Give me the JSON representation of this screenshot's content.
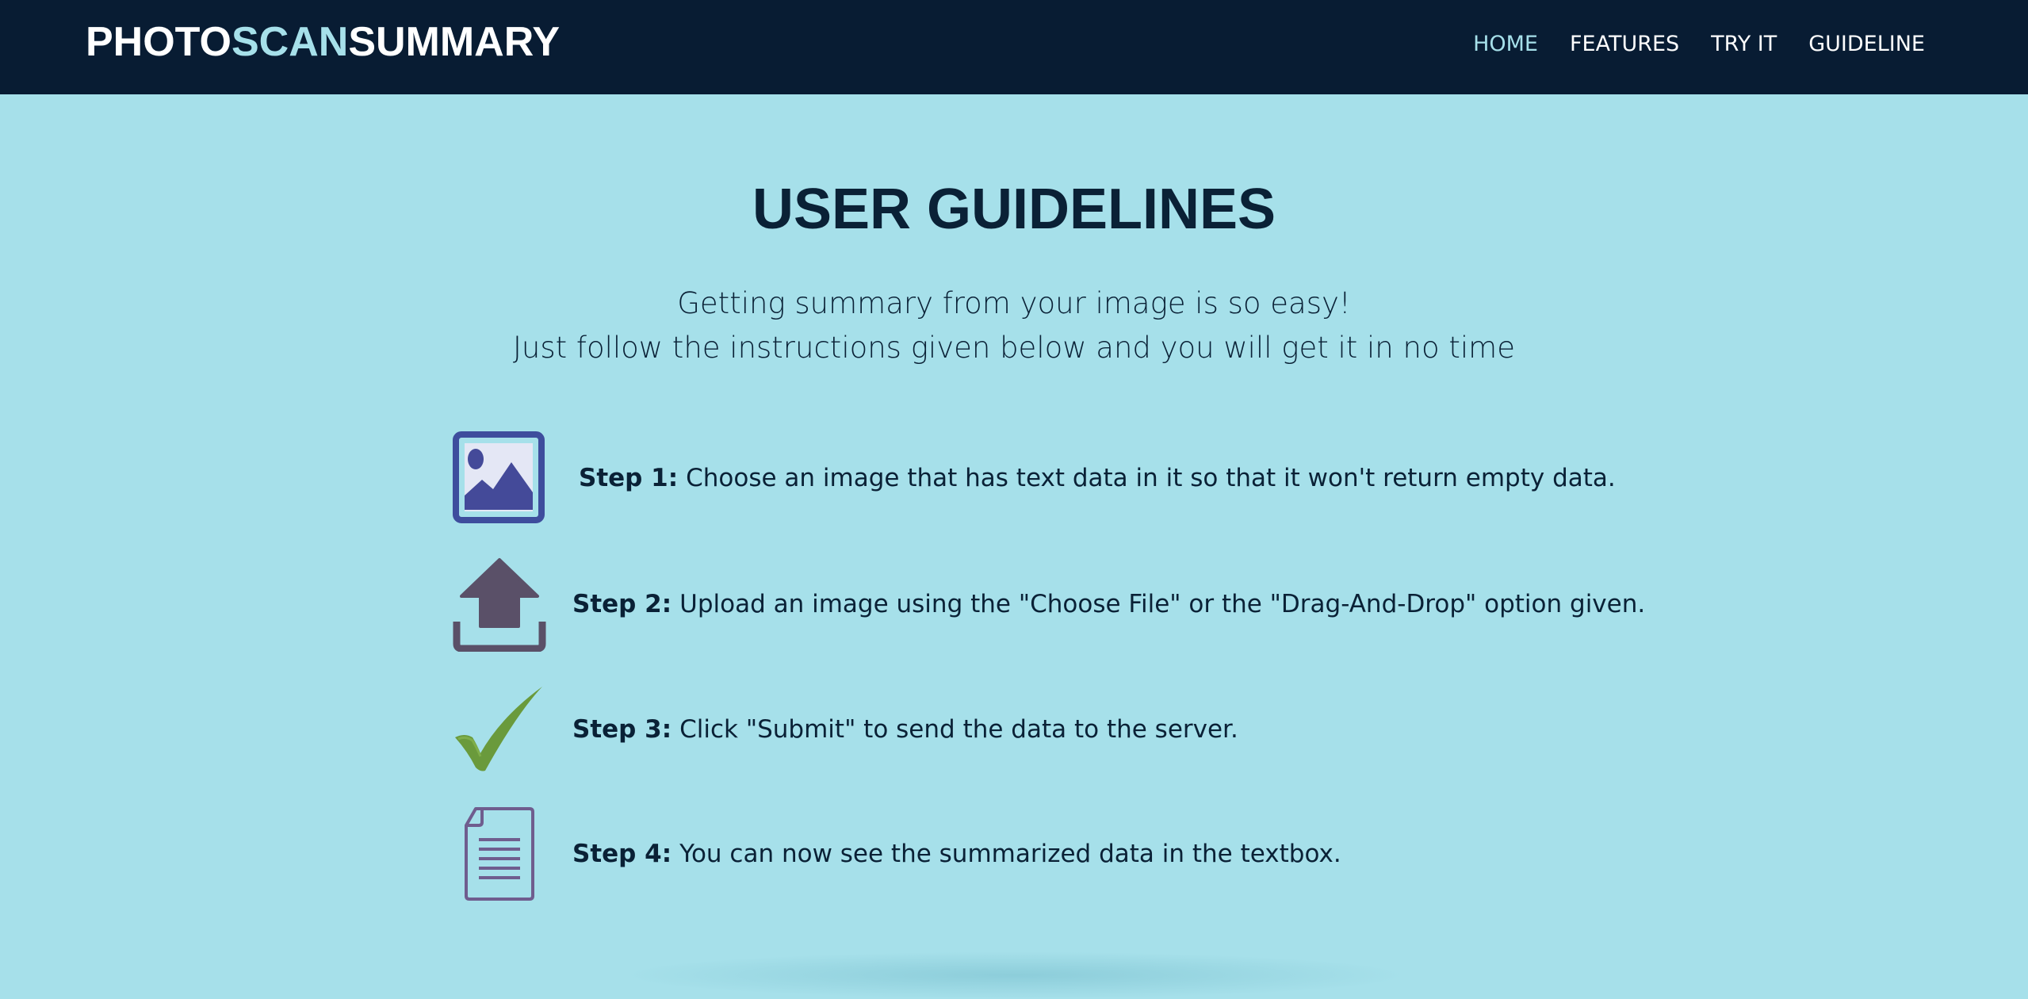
{
  "header": {
    "logo": {
      "part1": "PHOTO",
      "part2": "SCAN",
      "part3": "SUMMARY"
    },
    "nav": [
      {
        "label": "HOME",
        "active": true
      },
      {
        "label": "FEATURES",
        "active": false
      },
      {
        "label": "TRY IT",
        "active": false
      },
      {
        "label": "GUIDELINE",
        "active": false
      }
    ]
  },
  "main": {
    "title": "USER GUIDELINES",
    "subtitle_line1": "Getting summary from your image is so easy!",
    "subtitle_line2": "Just follow the instructions given below and you will get it in no time",
    "steps": [
      {
        "label": "Step 1:",
        "text": "Choose an image that has text data in it so that it won't return empty data.",
        "icon": "image-icon"
      },
      {
        "label": "Step 2:",
        "text": "Upload an image using the \"Choose File\" or the \"Drag-And-Drop\" option given.",
        "icon": "upload-icon"
      },
      {
        "label": "Step 3:",
        "text": "Click \"Submit\" to send the data to the server.",
        "icon": "checkmark-icon"
      },
      {
        "label": "Step 4:",
        "text": "You can now see the summarized data in the textbox.",
        "icon": "document-icon"
      }
    ]
  },
  "colors": {
    "navbar_bg": "#081c33",
    "page_bg": "#a6e0ea",
    "accent": "#a6e0ea",
    "text_dark": "#0a2136"
  }
}
